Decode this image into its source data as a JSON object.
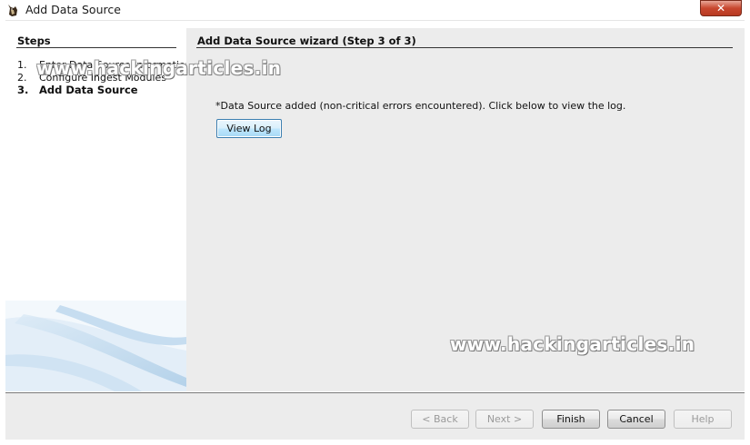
{
  "window": {
    "title": "Add Data Source",
    "close_glyph": "✕"
  },
  "icons": {
    "app": "autopsy-dog-icon",
    "close": "close-icon"
  },
  "steps_panel": {
    "heading": "Steps",
    "items": [
      {
        "number": "1.",
        "label": "Enter Data Source Information",
        "active": false
      },
      {
        "number": "2.",
        "label": "Configure Ingest Modules",
        "active": false
      },
      {
        "number": "3.",
        "label": "Add Data Source",
        "active": true
      }
    ]
  },
  "content": {
    "wizard_title": "Add Data Source wizard (Step 3 of 3)",
    "status_message": "*Data Source added (non-critical errors encountered). Click below to view the log.",
    "view_log_label": "View Log"
  },
  "buttons": {
    "back": "< Back",
    "next": "Next >",
    "finish": "Finish",
    "cancel": "Cancel",
    "help": "Help"
  },
  "watermark": "www.hackingarticles.in",
  "colors": {
    "content_bg": "#ececec",
    "accent_button_border": "#3c7fb1",
    "close_button": "#c8472f"
  }
}
